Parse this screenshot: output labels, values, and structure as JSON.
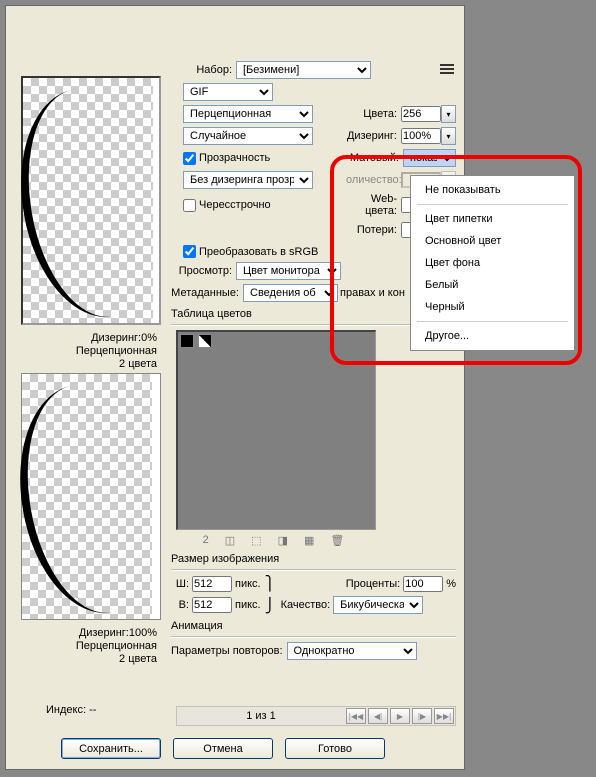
{
  "presets": {
    "label": "Набор:",
    "value": "[Безимени]"
  },
  "format": {
    "value": "GIF"
  },
  "palette": {
    "value": "Перцепционная"
  },
  "dither_method": {
    "value": "Случайное"
  },
  "colors": {
    "label": "Цвета:",
    "value": "256"
  },
  "dithering": {
    "label": "Дизеринг:",
    "value": "100%"
  },
  "transparency": {
    "label": "Прозрачность"
  },
  "matte": {
    "label": "Матовый:",
    "value": "показыва"
  },
  "no_trans_dither": {
    "value": "Без дизеринга прозр..."
  },
  "amount": {
    "label": "оличество:"
  },
  "interlaced": {
    "label": "Чересстрочно"
  },
  "web_colors": {
    "label": "Web-цвета:"
  },
  "loss": {
    "label": "Потери:"
  },
  "convert_srgb": {
    "label": "Преобразовать в sRGB"
  },
  "preview": {
    "label": "Просмотр:",
    "value": "Цвет монитора"
  },
  "metadata": {
    "label": "Метаданные:",
    "value": "Сведения об авт",
    "extra": "правах и кон"
  },
  "color_table": {
    "label": "Таблица цветов"
  },
  "table_count": "2",
  "image_size": {
    "label": "Размер изображения"
  },
  "width": {
    "label": "Ш:",
    "value": "512",
    "unit": "пикс."
  },
  "height": {
    "label": "В:",
    "value": "512",
    "unit": "пикс."
  },
  "percent": {
    "label": "Проценты:",
    "value": "100",
    "unit": "%"
  },
  "quality": {
    "label": "Качество:",
    "value": "Бикубическая"
  },
  "animation": {
    "label": "Анимация"
  },
  "loop": {
    "label": "Параметры повторов:",
    "value": "Однократно"
  },
  "index": {
    "label": "Индекс: --"
  },
  "pager": {
    "text": "1 из 1"
  },
  "preview_info1": {
    "line1": "Дизеринг:0%",
    "line2": "Перцепционная",
    "line3": "2 цвета"
  },
  "preview_info2": {
    "line1": "Дизеринг:100%",
    "line2": "Перцепционная",
    "line3": "2 цвета"
  },
  "buttons": {
    "save": "Сохранить...",
    "cancel": "Отмена",
    "done": "Готово"
  },
  "menu": {
    "i1": "Не показывать",
    "i2": "Цвет пипетки",
    "i3": "Основной цвет",
    "i4": "Цвет фона",
    "i5": "Белый",
    "i6": "Черный",
    "i7": "Другое..."
  }
}
